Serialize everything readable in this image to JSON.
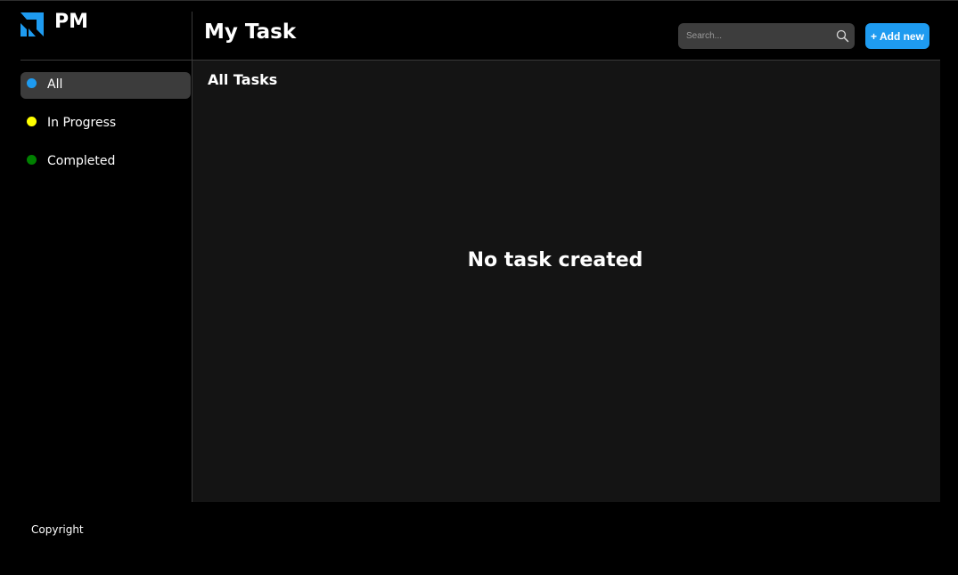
{
  "app": {
    "brand": "PM"
  },
  "header": {
    "title": "My Task",
    "search": {
      "placeholder": "Search...",
      "value": ""
    },
    "add_button_label": "+ Add new"
  },
  "sidebar": {
    "items": [
      {
        "label": "All",
        "dot_color": "#1e9bf0",
        "active": true
      },
      {
        "label": "In Progress",
        "dot_color": "#ffff00",
        "active": false
      },
      {
        "label": "Completed",
        "dot_color": "#008000",
        "active": false
      }
    ]
  },
  "main": {
    "section_title": "All Tasks",
    "empty_message": "No task created"
  },
  "footer": {
    "text": "Copyright"
  },
  "colors": {
    "accent": "#1e9bf0",
    "background": "#000000",
    "panel": "#141414"
  },
  "icons": {
    "logo": "brand-logo-icon",
    "search": "search-icon"
  }
}
